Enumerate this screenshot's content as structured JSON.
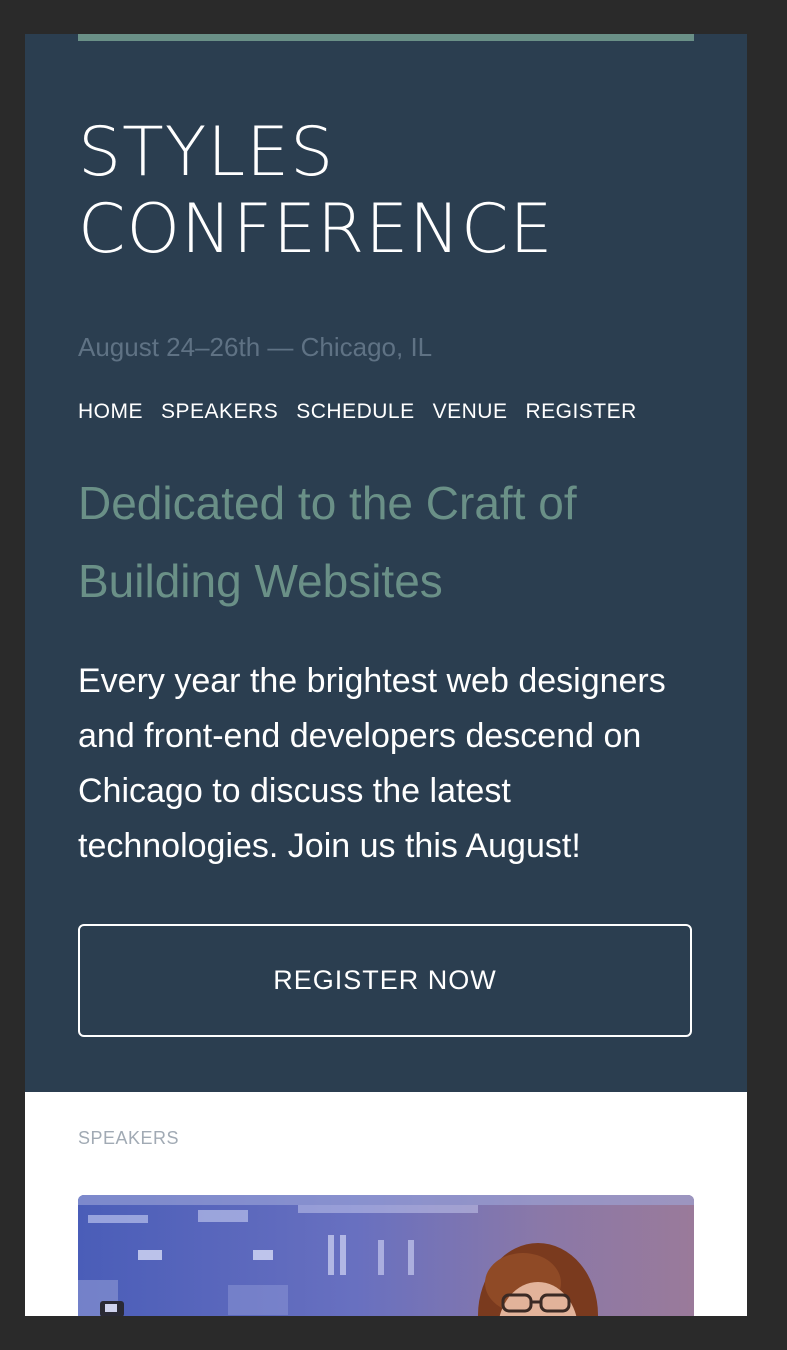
{
  "header": {
    "logo_line1": "STYLES",
    "logo_line2": "CONFERENCE",
    "tagline": "August 24–26th — Chicago, IL"
  },
  "nav": {
    "items": [
      {
        "label": "HOME"
      },
      {
        "label": "SPEAKERS"
      },
      {
        "label": "SCHEDULE"
      },
      {
        "label": "VENUE"
      },
      {
        "label": "REGISTER"
      }
    ]
  },
  "hero": {
    "headline": "Dedicated to the Craft of Building Websites",
    "lead": "Every year the brightest web designers and front-end developers descend on Chicago to discuss the latest technologies. Join us this August!",
    "cta_label": "REGISTER NOW"
  },
  "speakers": {
    "section_label": "SPEAKERS"
  },
  "colors": {
    "hero_background": "#2b3e50",
    "accent": "#6a9087",
    "tagline": "#5f7284",
    "section_label": "#a1aab4"
  }
}
